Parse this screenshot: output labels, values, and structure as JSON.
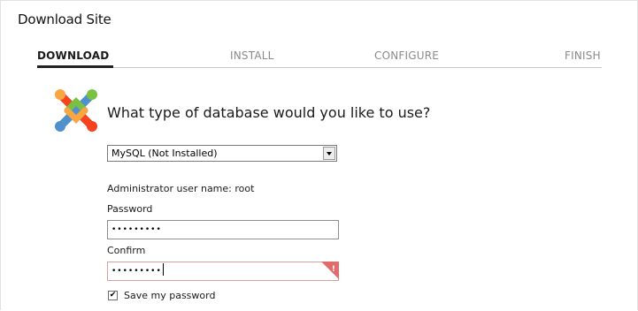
{
  "window": {
    "title": "Download Site"
  },
  "steps": [
    {
      "label": "DOWNLOAD",
      "active": true
    },
    {
      "label": "INSTALL",
      "active": false
    },
    {
      "label": "CONFIGURE",
      "active": false
    },
    {
      "label": "FINISH",
      "active": false
    }
  ],
  "logo": {
    "icon": "joomla-logo-icon"
  },
  "main": {
    "question": "What type of database would you like to use?",
    "database_select": {
      "value": "MySQL (Not Installed)"
    },
    "admin_user_text": "Administrator user name: root",
    "password_label": "Password",
    "password_value": "•••••••••",
    "confirm_label": "Confirm",
    "confirm_value": "•••••••••",
    "confirm_error_icon": "!",
    "save_password_label": "Save my password",
    "save_password_checked": true,
    "check_mark": "✔"
  },
  "colors": {
    "error": "#e06c6c",
    "active_step": "#222222",
    "inactive_step": "#8a8a8a"
  }
}
